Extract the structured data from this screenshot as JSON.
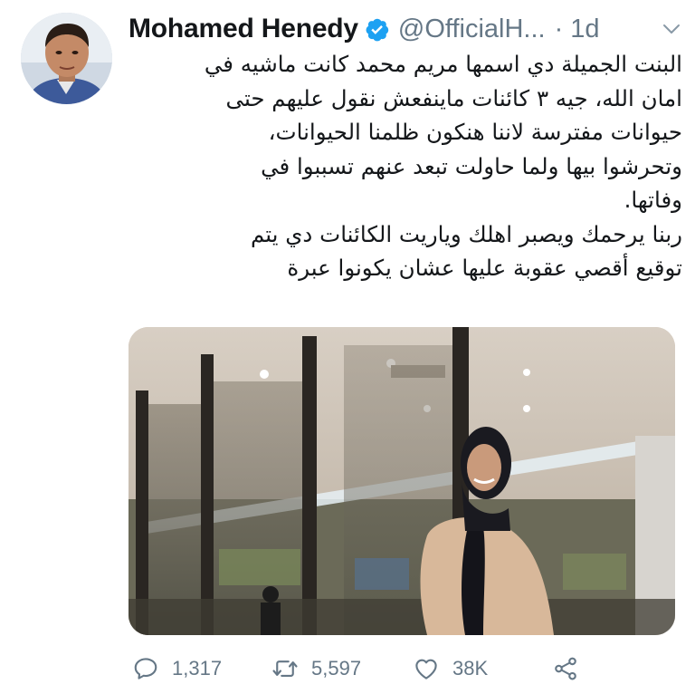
{
  "tweet": {
    "author": {
      "display_name": "Mohamed Henedy",
      "handle": "@OfficialH...",
      "verified": true
    },
    "separator": "·",
    "time": "1d",
    "text": "البنت الجميلة دي اسمها مريم محمد كانت ماشيه في\nامان الله، جيه ٣ كائنات ماينفعش نقول عليهم حتى\nحيوانات مفترسة لاننا هنكون ظلمنا الحيوانات،\nوتحرشوا بيها ولما حاولت تبعد عنهم تسببوا في\nوفاتها.\nربنا يرحمك ويصبر اهلك وياريت الكائنات دي يتم\nتوقيع أقصي عقوبة عليها عشان يكونوا عبرة",
    "actions": {
      "replies": "1,317",
      "retweets": "5,597",
      "likes": "38K"
    }
  },
  "icons": {
    "verified": "verified-badge-icon",
    "more": "chevron-down-icon",
    "reply": "reply-icon",
    "retweet": "retweet-icon",
    "like": "heart-icon",
    "share": "share-icon"
  },
  "colors": {
    "text": "#14171a",
    "secondary": "#657786",
    "verified": "#1da1f2"
  }
}
